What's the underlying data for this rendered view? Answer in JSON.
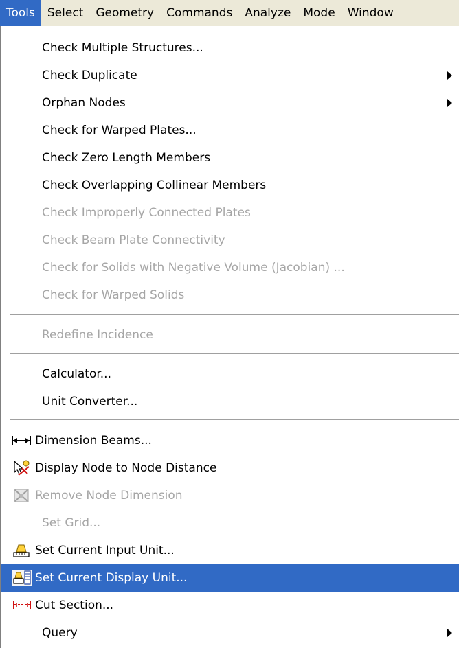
{
  "menubar": {
    "items": [
      {
        "label": "Tools",
        "active": true
      },
      {
        "label": "Select"
      },
      {
        "label": "Geometry"
      },
      {
        "label": "Commands"
      },
      {
        "label": "Analyze"
      },
      {
        "label": "Mode"
      },
      {
        "label": "Window"
      }
    ]
  },
  "dropdown": {
    "items": [
      {
        "label": "Check Multiple Structures..."
      },
      {
        "label": "Check Duplicate",
        "submenu": true
      },
      {
        "label": "Orphan Nodes",
        "submenu": true
      },
      {
        "label": "Check for Warped Plates..."
      },
      {
        "label": "Check Zero Length Members"
      },
      {
        "label": "Check Overlapping Collinear Members"
      },
      {
        "label": "Check Improperly Connected Plates",
        "disabled": true
      },
      {
        "label": "Check Beam Plate Connectivity",
        "disabled": true
      },
      {
        "label": "Check for Solids with Negative Volume (Jacobian) ...",
        "disabled": true
      },
      {
        "label": "Check for Warped Solids",
        "disabled": true
      },
      {
        "label": "Redefine Incidence",
        "disabled": true
      },
      {
        "label": "Calculator..."
      },
      {
        "label": "Unit Converter..."
      },
      {
        "label": "Dimension Beams...",
        "icon": "dimension-beams-icon"
      },
      {
        "label": "Display Node to Node Distance",
        "icon": "node-distance-icon"
      },
      {
        "label": "Remove Node Dimension",
        "icon": "remove-dimension-icon",
        "disabled": true
      },
      {
        "label": "Set Grid...",
        "disabled": true
      },
      {
        "label": "Set Current Input Unit...",
        "icon": "input-unit-icon"
      },
      {
        "label": "Set Current Display Unit...",
        "icon": "display-unit-icon",
        "highlighted": true
      },
      {
        "label": "Cut Section...",
        "icon": "cut-section-icon"
      },
      {
        "label": "Query",
        "submenu": true
      }
    ]
  },
  "colors": {
    "menubar_bg": "#ece9d8",
    "highlight": "#316ac5",
    "disabled_text": "#a6a6a6"
  }
}
